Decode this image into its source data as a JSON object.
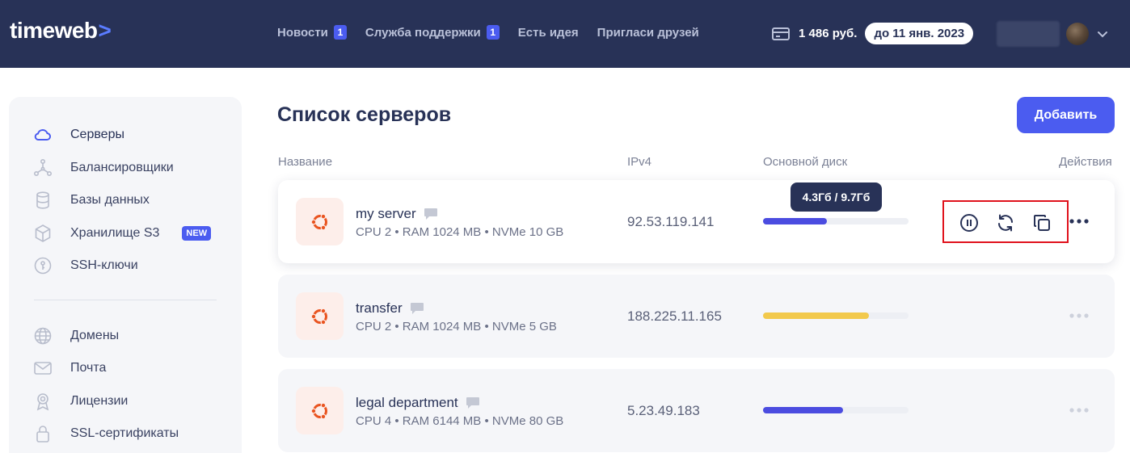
{
  "header": {
    "logo": "timeweb",
    "logo_chevron": ">",
    "nav": [
      {
        "label": "Новости",
        "badge": "1"
      },
      {
        "label": "Служба поддержки",
        "badge": "1"
      },
      {
        "label": "Есть идея"
      },
      {
        "label": "Пригласи друзей"
      }
    ],
    "balance": "1 486 руб.",
    "paid_until": "до 11 янв. 2023"
  },
  "sidebar": {
    "items": [
      {
        "label": "Серверы",
        "icon": "cloud-icon"
      },
      {
        "label": "Балансировщики",
        "icon": "balancer-icon"
      },
      {
        "label": "Базы данных",
        "icon": "database-icon"
      },
      {
        "label": "Хранилище S3",
        "icon": "cube-icon",
        "badge": "NEW"
      },
      {
        "label": "SSH-ключи",
        "icon": "key-icon"
      },
      {
        "label": "Домены",
        "icon": "globe-icon"
      },
      {
        "label": "Почта",
        "icon": "mail-icon"
      },
      {
        "label": "Лицензии",
        "icon": "award-icon"
      },
      {
        "label": "SSL-сертификаты",
        "icon": "lock-icon"
      }
    ]
  },
  "main": {
    "title": "Список серверов",
    "add_button": "Добавить",
    "columns": {
      "name": "Название",
      "ipv4": "IPv4",
      "disk": "Основной диск",
      "actions": "Действия"
    },
    "servers": [
      {
        "name": "my server",
        "specs": "CPU 2 • RAM 1024 MB • NVMe 10 GB",
        "ip": "92.53.119.141",
        "disk_usage": 0.44,
        "disk_color": "#4b4ce0"
      },
      {
        "name": "transfer",
        "specs": "CPU 2 • RAM 1024 MB • NVMe 5 GB",
        "ip": "188.225.11.165",
        "disk_usage": 0.73,
        "disk_color": "#f2c94c"
      },
      {
        "name": "legal department",
        "specs": "CPU 4 • RAM 6144 MB • NVMe 80 GB",
        "ip": "5.23.49.183",
        "disk_usage": 0.55,
        "disk_color": "#4b4ce0"
      }
    ],
    "tooltip": "4.3Гб / 9.7Гб"
  },
  "colors": {
    "header_bg": "#283257",
    "accent": "#4b5cf0",
    "ubuntu": "#e95420",
    "highlight_box": "#e0121c"
  }
}
